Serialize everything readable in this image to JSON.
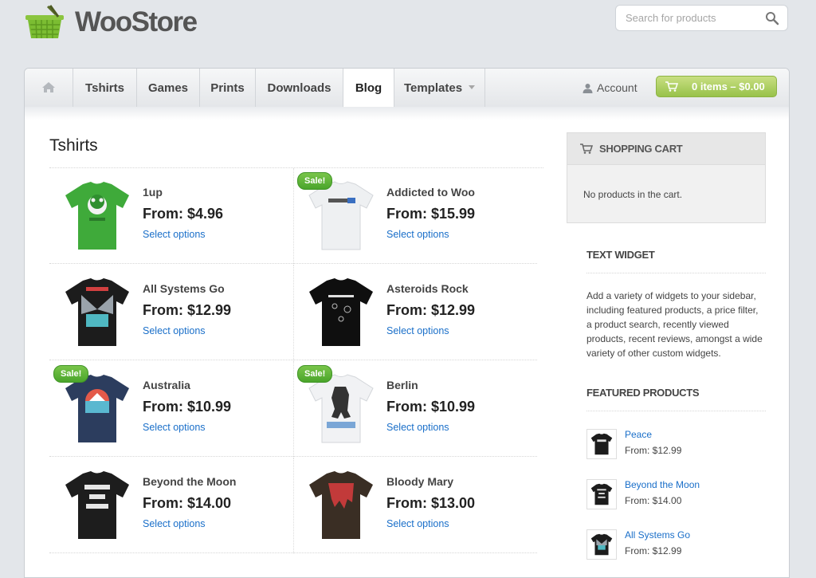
{
  "brand": {
    "name": "WooStore"
  },
  "search": {
    "placeholder": "Search for products"
  },
  "nav": {
    "items": [
      {
        "label": "Tshirts"
      },
      {
        "label": "Games"
      },
      {
        "label": "Prints"
      },
      {
        "label": "Downloads"
      },
      {
        "label": "Blog"
      },
      {
        "label": "Templates"
      }
    ],
    "account_label": "Account",
    "cart_label": "0 items – $0.00"
  },
  "page": {
    "title": "Tshirts"
  },
  "products": [
    {
      "name": "1up",
      "price": "From: $4.96",
      "link": "Select options",
      "sale": ""
    },
    {
      "name": "Addicted to Woo",
      "price": "From: $15.99",
      "link": "Select options",
      "sale": "Sale!"
    },
    {
      "name": "All Systems Go",
      "price": "From: $12.99",
      "link": "Select options",
      "sale": ""
    },
    {
      "name": "Asteroids Rock",
      "price": "From: $12.99",
      "link": "Select options",
      "sale": ""
    },
    {
      "name": "Australia",
      "price": "From: $10.99",
      "link": "Select options",
      "sale": "Sale!"
    },
    {
      "name": "Berlin",
      "price": "From: $10.99",
      "link": "Select options",
      "sale": "Sale!"
    },
    {
      "name": "Beyond the Moon",
      "price": "From: $14.00",
      "link": "Select options",
      "sale": ""
    },
    {
      "name": "Bloody Mary",
      "price": "From: $13.00",
      "link": "Select options",
      "sale": ""
    }
  ],
  "sidebar": {
    "cart_title": "SHOPPING CART",
    "cart_empty": "No products in the cart.",
    "text_widget_title": "TEXT WIDGET",
    "text_widget_body": "Add a variety of widgets to your sidebar, including featured products, a price filter, a product search, recently viewed products, recent reviews, amongst a wide variety of other custom widgets.",
    "featured_title": "FEATURED PRODUCTS",
    "featured": [
      {
        "name": "Peace",
        "price": "From: $12.99"
      },
      {
        "name": "Beyond the Moon",
        "price": "From: $14.00"
      },
      {
        "name": "All Systems Go",
        "price": "From: $12.99"
      }
    ]
  },
  "colors": {
    "accent_green": "#98c24a",
    "sale_green": "#4aa52b",
    "link_blue": "#1a6fc9",
    "page_bg": "#e3e6ea"
  },
  "icons": [
    "basket-logo-icon",
    "search-icon",
    "home-icon",
    "user-icon",
    "cart-icon"
  ]
}
